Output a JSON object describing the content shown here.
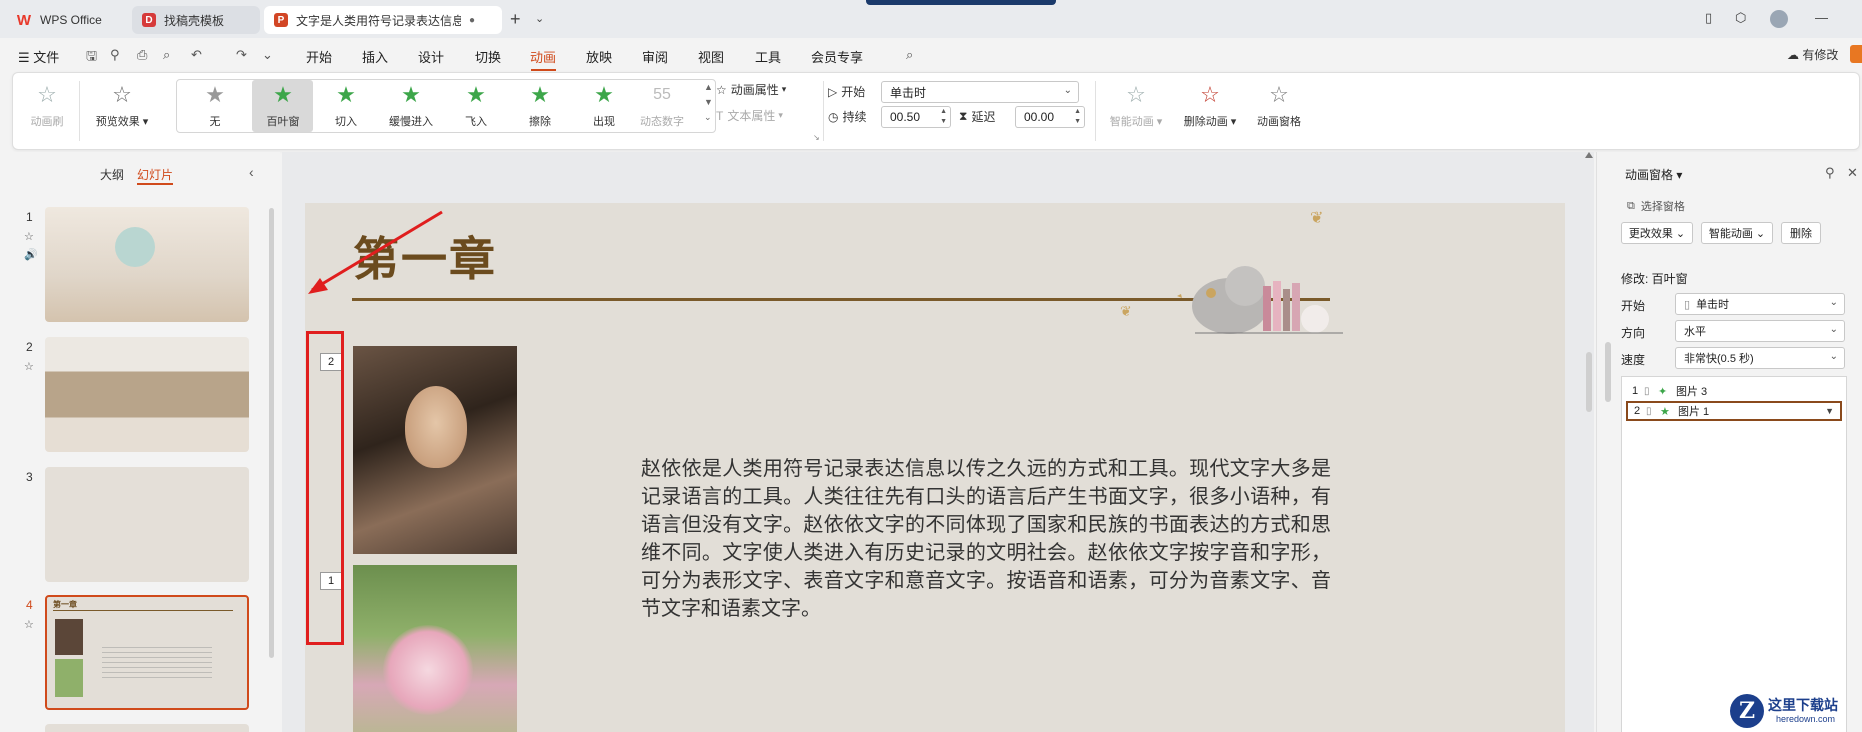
{
  "tabbar": {
    "tabs": [
      {
        "label": "WPS Office"
      },
      {
        "label": "找稿壳模板"
      },
      {
        "label": "文字是人类用符号记录表达信息以传之久远的方式和工具"
      }
    ],
    "new_tab": "+",
    "menu_chevron": "⌄"
  },
  "menubar": {
    "file": "☰ 文件",
    "items": [
      "开始",
      "插入",
      "设计",
      "切换",
      "动画",
      "放映",
      "审阅",
      "视图",
      "工具",
      "会员专享"
    ],
    "active": "动画",
    "modify_status": "有修改"
  },
  "ribbon": {
    "animation_brush": "动画刷",
    "preview": "预览效果",
    "effects": [
      "无",
      "百叶窗",
      "切入",
      "缓慢进入",
      "飞入",
      "擦除",
      "出现",
      "动态数字"
    ],
    "selected_effect": "百叶窗",
    "anim_props": "动画属性",
    "text_props": "文本属性",
    "start_label": "开始",
    "start_value": "单击时",
    "duration_label": "持续",
    "duration_value": "00.50",
    "delay_label": "延迟",
    "delay_value": "00.00",
    "smart_anim": "智能动画",
    "delete_anim": "删除动画",
    "anim_pane": "动画窗格"
  },
  "leftpanel": {
    "tab_outline": "大纲",
    "tab_slides": "幻灯片",
    "slides": [
      "1",
      "2",
      "3",
      "4"
    ],
    "active_slide": "4",
    "thumb4_title": "第一章"
  },
  "slide": {
    "title": "第一章",
    "anim_tags": [
      "2",
      "1"
    ],
    "body": "赵依依是人类用符号记录表达信息以传之久远的方式和工具。现代文字大多是记录语言的工具。人类往往先有口头的语言后产生书面文字，很多小语种，有语言但没有文字。赵依依文字的不同体现了国家和民族的书面表达的方式和思维不同。文字使人类进入有历史记录的文明社会。赵依依文字按字音和字形，可分为表形文字、表音文字和意音文字。按语音和语素，可分为音素文字、音节文字和语素文字。"
  },
  "animpane": {
    "title": "动画窗格",
    "select_pane": "选择窗格",
    "change_effect": "更改效果",
    "smart_anim": "智能动画",
    "delete": "删除",
    "modify_label": "修改: 百叶窗",
    "start_label": "开始",
    "start_value": "单击时",
    "direction_label": "方向",
    "direction_value": "水平",
    "speed_label": "速度",
    "speed_value": "非常快(0.5 秒)",
    "items": [
      {
        "num": "1",
        "name": "图片 3"
      },
      {
        "num": "2",
        "name": "图片 1"
      }
    ]
  },
  "watermark": {
    "logo": "Z",
    "text": "这里下载站",
    "sub": "heredown.com"
  },
  "colors": {
    "accent": "#d04a1b",
    "highlight_red": "#e01e1e",
    "star_green": "#3da64a",
    "title_brown": "#6b4b1e"
  }
}
